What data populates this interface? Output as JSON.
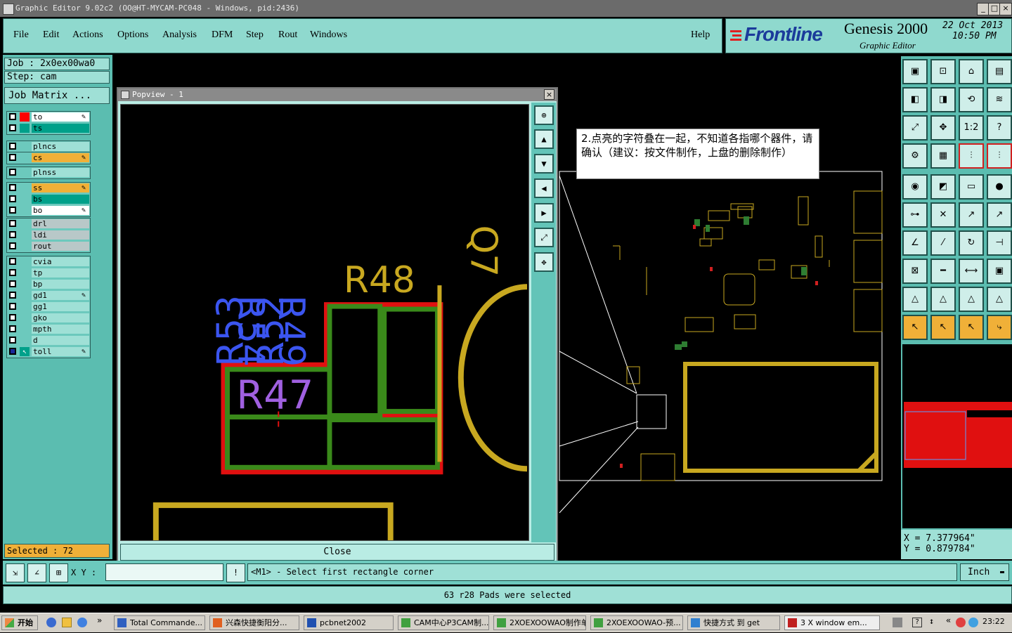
{
  "window": {
    "title": "Graphic Editor 9.02c2 (OO@HT-MYCAM-PC048 - Windows, pid:2436)"
  },
  "menu": {
    "items": [
      "File",
      "Edit",
      "Actions",
      "Options",
      "Analysis",
      "DFM",
      "Step",
      "Rout",
      "Windows"
    ],
    "help": "Help"
  },
  "brand": {
    "logo": "Frontline",
    "product": "Genesis 2000",
    "subtitle": "Graphic Editor",
    "date": "22 Oct 2013",
    "time": "10:50 PM"
  },
  "job": {
    "job_label": "Job : 2x0ex00wa0",
    "step_label": "Step: cam",
    "matrix_button": "Job Matrix ..."
  },
  "layers": [
    {
      "name": "to",
      "color": "#ff0000",
      "bg": "#ffffff",
      "flag": "✎"
    },
    {
      "name": "ts",
      "color": "#00a08a",
      "bg": "#00a08a",
      "flag": ""
    },
    {
      "name": "plncs",
      "color": "",
      "bg": "#9fe0d6",
      "flag": ""
    },
    {
      "name": "cs",
      "color": "",
      "bg": "#f0b038",
      "flag": "✎"
    },
    {
      "name": "plnss",
      "color": "",
      "bg": "#9fe0d6",
      "flag": ""
    },
    {
      "name": "ss",
      "color": "",
      "bg": "#f0b038",
      "flag": "✎"
    },
    {
      "name": "bs",
      "color": "",
      "bg": "#00a08a",
      "flag": ""
    },
    {
      "name": "bo",
      "color": "",
      "bg": "#ffffff",
      "flag": "✎"
    },
    {
      "name": "drl",
      "color": "",
      "bg": "#b8c8c8",
      "flag": ""
    },
    {
      "name": "ldi",
      "color": "",
      "bg": "#b8c8c8",
      "flag": ""
    },
    {
      "name": "rout",
      "color": "",
      "bg": "#b8c8c8",
      "flag": ""
    },
    {
      "name": "cvia",
      "color": "",
      "bg": "#9fe0d6",
      "flag": ""
    },
    {
      "name": "tp",
      "color": "",
      "bg": "#9fe0d6",
      "flag": ""
    },
    {
      "name": "bp",
      "color": "",
      "bg": "#9fe0d6",
      "flag": ""
    },
    {
      "name": "gd1",
      "color": "",
      "bg": "#9fe0d6",
      "flag": "✎"
    },
    {
      "name": "gg1",
      "color": "",
      "bg": "#9fe0d6",
      "flag": ""
    },
    {
      "name": "gko",
      "color": "",
      "bg": "#9fe0d6",
      "flag": ""
    },
    {
      "name": "mpth",
      "color": "",
      "bg": "#9fe0d6",
      "flag": ""
    },
    {
      "name": "d",
      "color": "",
      "bg": "#9fe0d6",
      "flag": ""
    },
    {
      "name": "toll",
      "color": "#00a08a",
      "bg": "#9fe0d6",
      "flag": "✎"
    }
  ],
  "selected_label": "Selected : 72",
  "popup": {
    "title": "Popview - 1",
    "close": "Close",
    "labels": {
      "r48": "R48",
      "r47": "R47",
      "q7": "Q7"
    }
  },
  "annotation": "2.点亮的字符叠在一起，不知道各指哪个器件，请确认（建议：按文件制作，上盘的删除制作）",
  "coords": {
    "x": "X = 7.377964\"",
    "y": "Y = 0.879784\""
  },
  "command": {
    "xy_label": "X Y :",
    "xy_value": "",
    "prompt": "<M1> - Select first rectangle corner",
    "units": "Inch"
  },
  "status": "63 r28 Pads were selected",
  "taskbar": {
    "start": "开始",
    "tasks": [
      "Total Commande...",
      "兴森快捷衡阳分...",
      "pcbnet2002",
      "CAM中心P3CAM制...",
      "2XOEXOOWAO制作单",
      "2XOEXOOWAO-预...",
      "快捷方式 到 get",
      "3 X window em..."
    ],
    "clock": "23:22"
  }
}
